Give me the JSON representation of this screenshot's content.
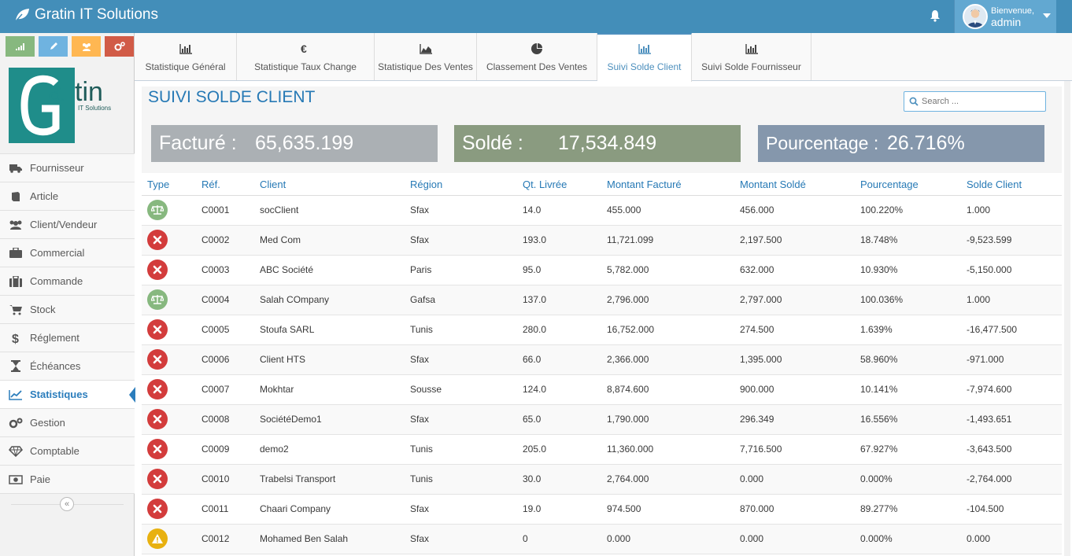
{
  "app": {
    "title": "Gratin IT Solutions"
  },
  "user": {
    "greeting": "Bienvenue,",
    "name": "admin"
  },
  "logo": {
    "main": "Gatin",
    "sub": "IT Solutions"
  },
  "colors": {
    "header": "#438eb9",
    "accent": "#2679b5",
    "success": "#87b87f",
    "info": "#6fb3e0",
    "warning": "#ffb752",
    "danger": "#d15b47"
  },
  "sidebar": {
    "shortcuts": [
      {
        "icon": "signal-icon",
        "color": "#87b87f"
      },
      {
        "icon": "pencil-icon",
        "color": "#6fb3e0"
      },
      {
        "icon": "users-icon",
        "color": "#ffb752"
      },
      {
        "icon": "cogs-icon",
        "color": "#d15b47"
      }
    ],
    "items": [
      {
        "label": "Fournisseur",
        "icon": "truck-icon"
      },
      {
        "label": "Article",
        "icon": "book-icon"
      },
      {
        "label": "Client/Vendeur",
        "icon": "users-icon"
      },
      {
        "label": "Commercial",
        "icon": "briefcase-icon"
      },
      {
        "label": "Commande",
        "icon": "suitcase-icon"
      },
      {
        "label": "Stock",
        "icon": "cart-icon"
      },
      {
        "label": "Réglement",
        "icon": "dollar-icon"
      },
      {
        "label": "Échéances",
        "icon": "hourglass-icon"
      },
      {
        "label": "Statistiques",
        "icon": "chart-line-icon"
      },
      {
        "label": "Gestion",
        "icon": "cogs-icon"
      },
      {
        "label": "Comptable",
        "icon": "diamond-icon"
      },
      {
        "label": "Paie",
        "icon": "money-icon"
      }
    ],
    "collapse": "«"
  },
  "tabs": [
    {
      "label": "Statistique Général",
      "icon": "bar-chart-icon"
    },
    {
      "label": "Statistique Taux Change",
      "icon": "euro-icon"
    },
    {
      "label": "Statistique Des Ventes",
      "icon": "area-chart-icon"
    },
    {
      "label": "Classement Des Ventes",
      "icon": "pie-chart-icon"
    },
    {
      "label": "Suivi Solde Client",
      "icon": "bar-chart-icon"
    },
    {
      "label": "Suivi Solde Fournisseur",
      "icon": "bar-chart-icon"
    }
  ],
  "page": {
    "title": "SUIVI SOLDE CLIENT",
    "search_placeholder": "Search ..."
  },
  "summary": {
    "facture_label": "Facturé :",
    "facture_value": "65,635.199",
    "solde_label": "Soldé :",
    "solde_value": "17,534.849",
    "pourcentage_label": "Pourcentage :",
    "pourcentage_value": "26.716%"
  },
  "table": {
    "headers": [
      "Type",
      "Réf.",
      "Client",
      "Région",
      "Qt. Livrée",
      "Montant Facturé",
      "Montant Soldé",
      "Pourcentage",
      "Solde Client"
    ],
    "rows": [
      {
        "type": "balance",
        "ref": "C0001",
        "client": "socClient",
        "region": "Sfax",
        "qt": "14.0",
        "facture": "455.000",
        "solde": "456.000",
        "pct": "100.220%",
        "solde_client": "1.000"
      },
      {
        "type": "unpaid",
        "ref": "C0002",
        "client": "Med Com",
        "region": "Sfax",
        "qt": "193.0",
        "facture": "11,721.099",
        "solde": "2,197.500",
        "pct": "18.748%",
        "solde_client": "-9,523.599"
      },
      {
        "type": "unpaid",
        "ref": "C0003",
        "client": "ABC Société",
        "region": "Paris",
        "qt": "95.0",
        "facture": "5,782.000",
        "solde": "632.000",
        "pct": "10.930%",
        "solde_client": "-5,150.000"
      },
      {
        "type": "balance",
        "ref": "C0004",
        "client": "Salah COmpany",
        "region": "Gafsa",
        "qt": "137.0",
        "facture": "2,796.000",
        "solde": "2,797.000",
        "pct": "100.036%",
        "solde_client": "1.000"
      },
      {
        "type": "unpaid",
        "ref": "C0005",
        "client": "Stoufa SARL",
        "region": "Tunis",
        "qt": "280.0",
        "facture": "16,752.000",
        "solde": "274.500",
        "pct": "1.639%",
        "solde_client": "-16,477.500"
      },
      {
        "type": "unpaid",
        "ref": "C0006",
        "client": "Client HTS",
        "region": "Sfax",
        "qt": "66.0",
        "facture": "2,366.000",
        "solde": "1,395.000",
        "pct": "58.960%",
        "solde_client": "-971.000"
      },
      {
        "type": "unpaid",
        "ref": "C0007",
        "client": "Mokhtar",
        "region": "Sousse",
        "qt": "124.0",
        "facture": "8,874.600",
        "solde": "900.000",
        "pct": "10.141%",
        "solde_client": "-7,974.600"
      },
      {
        "type": "unpaid",
        "ref": "C0008",
        "client": "SociétéDemo1",
        "region": "Sfax",
        "qt": "65.0",
        "facture": "1,790.000",
        "solde": "296.349",
        "pct": "16.556%",
        "solde_client": "-1,493.651"
      },
      {
        "type": "unpaid",
        "ref": "C0009",
        "client": "demo2",
        "region": "Tunis",
        "qt": "205.0",
        "facture": "11,360.000",
        "solde": "7,716.500",
        "pct": "67.927%",
        "solde_client": "-3,643.500"
      },
      {
        "type": "unpaid",
        "ref": "C0010",
        "client": "Trabelsi Transport",
        "region": "Tunis",
        "qt": "30.0",
        "facture": "2,764.000",
        "solde": "0.000",
        "pct": "0.000%",
        "solde_client": "-2,764.000"
      },
      {
        "type": "unpaid",
        "ref": "C0011",
        "client": "Chaari Company",
        "region": "Sfax",
        "qt": "19.0",
        "facture": "974.500",
        "solde": "870.000",
        "pct": "89.277%",
        "solde_client": "-104.500"
      },
      {
        "type": "warning",
        "ref": "C0012",
        "client": "Mohamed Ben Salah",
        "region": "Sfax",
        "qt": "0",
        "facture": "0.000",
        "solde": "0.000",
        "pct": "0.000%",
        "solde_client": "0.000"
      }
    ]
  }
}
